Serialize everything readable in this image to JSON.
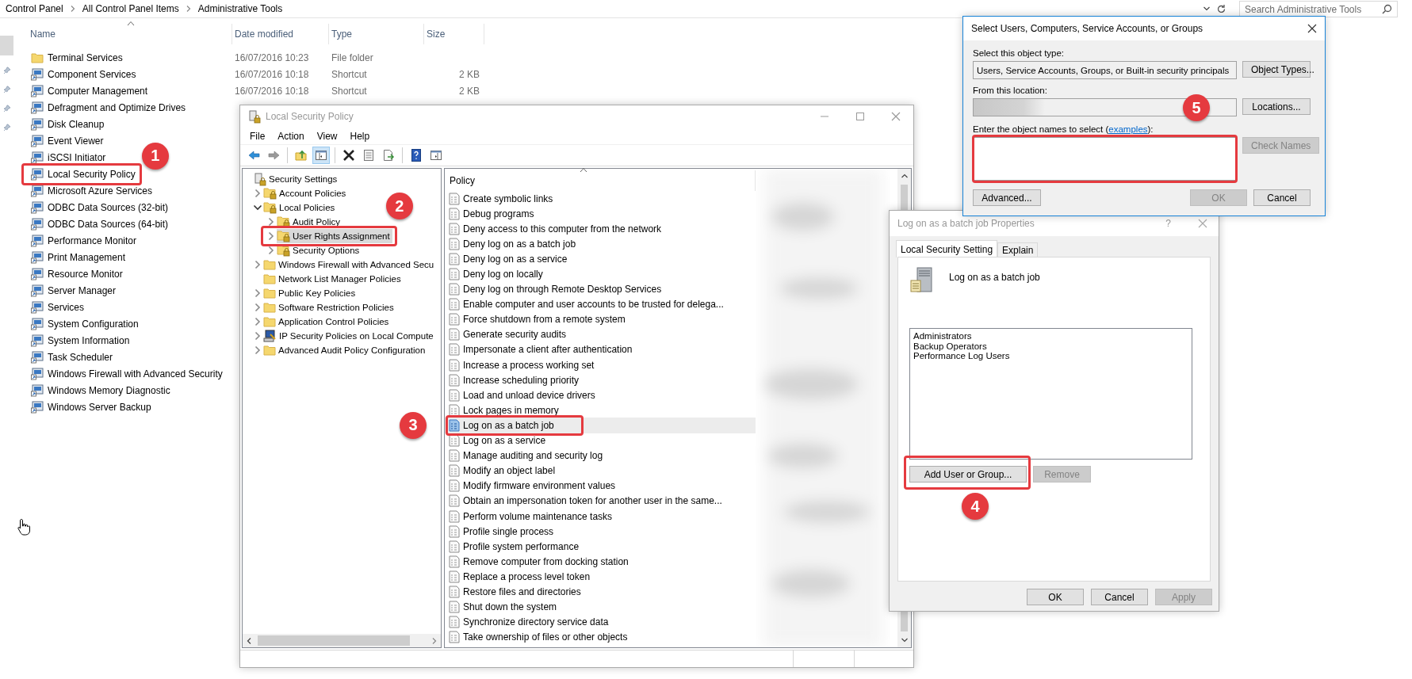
{
  "explorer": {
    "breadcrumb": [
      "Control Panel",
      "All Control Panel Items",
      "Administrative Tools"
    ],
    "search": {
      "placeholder": "Search Administrative Tools"
    },
    "columns": [
      "Name",
      "Date modified",
      "Type",
      "Size"
    ],
    "items": [
      {
        "name": "Terminal Services",
        "kind": "folder",
        "date": "16/07/2016 10:23",
        "type": "File folder"
      },
      {
        "name": "Component Services",
        "kind": "shortcut",
        "date": "16/07/2016 10:18",
        "type": "Shortcut",
        "size": "2 KB"
      },
      {
        "name": "Computer Management",
        "kind": "shortcut",
        "date": "16/07/2016 10:18",
        "type": "Shortcut",
        "size": "2 KB"
      },
      {
        "name": "Defragment and Optimize Drives",
        "kind": "shortcut"
      },
      {
        "name": "Disk Cleanup",
        "kind": "shortcut"
      },
      {
        "name": "Event Viewer",
        "kind": "shortcut"
      },
      {
        "name": "iSCSI Initiator",
        "kind": "shortcut"
      },
      {
        "name": "Local Security Policy",
        "kind": "shortcut",
        "callout": "1"
      },
      {
        "name": "Microsoft Azure Services",
        "kind": "shortcut"
      },
      {
        "name": "ODBC Data Sources (32-bit)",
        "kind": "shortcut"
      },
      {
        "name": "ODBC Data Sources (64-bit)",
        "kind": "shortcut"
      },
      {
        "name": "Performance Monitor",
        "kind": "shortcut"
      },
      {
        "name": "Print Management",
        "kind": "shortcut"
      },
      {
        "name": "Resource Monitor",
        "kind": "shortcut"
      },
      {
        "name": "Server Manager",
        "kind": "shortcut"
      },
      {
        "name": "Services",
        "kind": "shortcut"
      },
      {
        "name": "System Configuration",
        "kind": "shortcut"
      },
      {
        "name": "System Information",
        "kind": "shortcut"
      },
      {
        "name": "Task Scheduler",
        "kind": "shortcut"
      },
      {
        "name": "Windows Firewall with Advanced Security",
        "kind": "shortcut"
      },
      {
        "name": "Windows Memory Diagnostic",
        "kind": "shortcut"
      },
      {
        "name": "Windows Server Backup",
        "kind": "shortcut"
      }
    ]
  },
  "policy_window": {
    "title": "Local Security Policy",
    "menu": [
      "File",
      "Action",
      "View",
      "Help"
    ],
    "toolbar": [
      [
        {
          "kind": "back",
          "pressed": false
        },
        {
          "kind": "forward",
          "pressed": false
        }
      ],
      [
        {
          "kind": "up",
          "pressed": false
        },
        {
          "kind": "tree",
          "pressed": true
        }
      ],
      [
        {
          "kind": "delete",
          "pressed": false
        },
        {
          "kind": "properties",
          "pressed": false
        },
        {
          "kind": "export",
          "pressed": false
        }
      ],
      [
        {
          "kind": "help",
          "pressed": false
        },
        {
          "kind": "view",
          "pressed": false
        }
      ]
    ],
    "tree": [
      {
        "label": "Security Settings",
        "kind": "root",
        "expandable": false,
        "selected": false,
        "children": [
          {
            "label": "Account Policies",
            "kind": "lock-folder",
            "expandable": true,
            "expanded": false,
            "selected": false
          },
          {
            "label": "Local Policies",
            "kind": "lock-folder",
            "expandable": true,
            "expanded": true,
            "selected": false,
            "children": [
              {
                "label": "Audit Policy",
                "kind": "lock-folder",
                "expandable": true,
                "expanded": false,
                "selected": false
              },
              {
                "label": "User Rights Assignment",
                "kind": "lock-folder",
                "expandable": true,
                "expanded": false,
                "selected": true,
                "callout": "2"
              },
              {
                "label": "Security Options",
                "kind": "lock-folder",
                "expandable": true,
                "expanded": false,
                "selected": false
              }
            ]
          },
          {
            "label": "Windows Firewall with Advanced Secu",
            "kind": "folder",
            "expandable": true,
            "expanded": false,
            "selected": false
          },
          {
            "label": "Network List Manager Policies",
            "kind": "folder",
            "expandable": false,
            "selected": false
          },
          {
            "label": "Public Key Policies",
            "kind": "folder",
            "expandable": true,
            "expanded": false,
            "selected": false
          },
          {
            "label": "Software Restriction Policies",
            "kind": "folder",
            "expandable": true,
            "expanded": false,
            "selected": false
          },
          {
            "label": "Application Control Policies",
            "kind": "folder",
            "expandable": true,
            "expanded": false,
            "selected": false
          },
          {
            "label": "IP Security Policies on Local Compute",
            "kind": "ip",
            "expandable": true,
            "expanded": false,
            "selected": false
          },
          {
            "label": "Advanced Audit Policy Configuration",
            "kind": "folder",
            "expandable": true,
            "expanded": false,
            "selected": false
          }
        ]
      }
    ],
    "policy_column": "Policy",
    "policies": [
      {
        "name": "Create symbolic links",
        "selected": false
      },
      {
        "name": "Debug programs",
        "selected": false
      },
      {
        "name": "Deny access to this computer from the network",
        "selected": false
      },
      {
        "name": "Deny log on as a batch job",
        "selected": false
      },
      {
        "name": "Deny log on as a service",
        "selected": false
      },
      {
        "name": "Deny log on locally",
        "selected": false
      },
      {
        "name": "Deny log on through Remote Desktop Services",
        "selected": false
      },
      {
        "name": "Enable computer and user accounts to be trusted for delega...",
        "selected": false
      },
      {
        "name": "Force shutdown from a remote system",
        "selected": false
      },
      {
        "name": "Generate security audits",
        "selected": false
      },
      {
        "name": "Impersonate a client after authentication",
        "selected": false
      },
      {
        "name": "Increase a process working set",
        "selected": false
      },
      {
        "name": "Increase scheduling priority",
        "selected": false
      },
      {
        "name": "Load and unload device drivers",
        "selected": false
      },
      {
        "name": "Lock pages in memory",
        "selected": false
      },
      {
        "name": "Log on as a batch job",
        "selected": true,
        "callout": "3"
      },
      {
        "name": "Log on as a service",
        "selected": false
      },
      {
        "name": "Manage auditing and security log",
        "selected": false
      },
      {
        "name": "Modify an object label",
        "selected": false
      },
      {
        "name": "Modify firmware environment values",
        "selected": false
      },
      {
        "name": "Obtain an impersonation token for another user in the same...",
        "selected": false
      },
      {
        "name": "Perform volume maintenance tasks",
        "selected": false
      },
      {
        "name": "Profile single process",
        "selected": false
      },
      {
        "name": "Profile system performance",
        "selected": false
      },
      {
        "name": "Remove computer from docking station",
        "selected": false
      },
      {
        "name": "Replace a process level token",
        "selected": false
      },
      {
        "name": "Restore files and directories",
        "selected": false
      },
      {
        "name": "Shut down the system",
        "selected": false
      },
      {
        "name": "Synchronize directory service data",
        "selected": false
      },
      {
        "name": "Take ownership of files or other objects",
        "selected": false
      }
    ]
  },
  "properties_dialog": {
    "title": "Log on as a batch job Properties",
    "help": "?",
    "tabs": [
      {
        "label": "Local Security Setting",
        "selected": true
      },
      {
        "label": "Explain",
        "selected": false
      }
    ],
    "setting": "Log on as a batch job",
    "members": [
      "Administrators",
      "Backup Operators",
      "Performance Log Users"
    ],
    "buttons": [
      {
        "label": "Add User or Group...",
        "disabled": false,
        "callout": "4"
      },
      {
        "label": "Remove",
        "disabled": true
      }
    ],
    "footer": [
      {
        "label": "OK",
        "disabled": false
      },
      {
        "label": "Cancel",
        "disabled": false
      },
      {
        "label": "Apply",
        "disabled": true
      }
    ]
  },
  "select_dialog": {
    "title": "Select Users, Computers, Service Accounts, or Groups",
    "object_type_label": "Select this object type:",
    "object_type": "Users, Service Accounts, Groups, or Built-in security principals",
    "object_types_button": {
      "label": "Object Types...",
      "disabled": false
    },
    "location_label": "From this location:",
    "locations_button": {
      "label": "Locations...",
      "disabled": false
    },
    "names_label": {
      "before": "Enter the object names to select (",
      "link": "examples",
      "after": "):"
    },
    "names_callout": "5",
    "check_names_button": {
      "label": "Check Names",
      "disabled": true
    },
    "advanced_button": {
      "label": "Advanced...",
      "disabled": false
    },
    "ok_button": {
      "label": "OK",
      "disabled": true
    },
    "cancel_button": {
      "label": "Cancel",
      "disabled": false
    }
  }
}
